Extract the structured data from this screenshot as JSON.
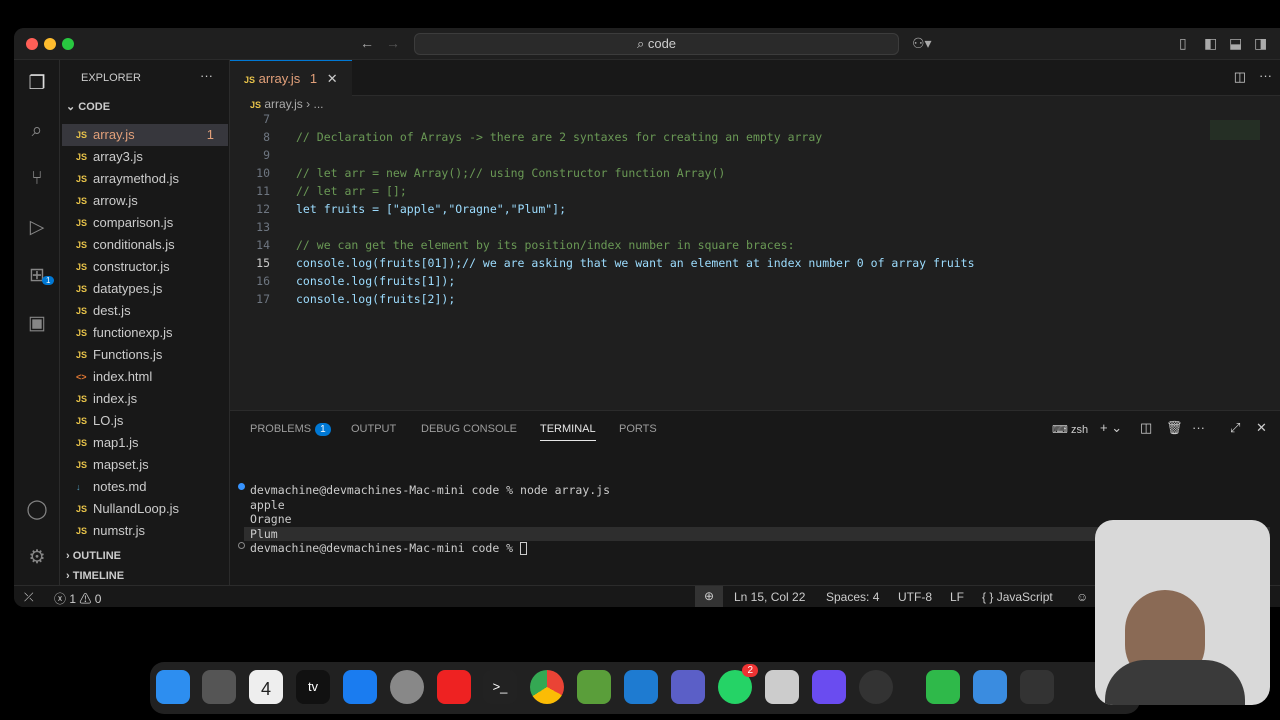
{
  "titlebar": {
    "search": "code"
  },
  "sidebar": {
    "title": "EXPLORER",
    "folder": "CODE",
    "files": [
      {
        "name": "array.js",
        "icon": "JS",
        "badge": "1"
      },
      {
        "name": "array3.js",
        "icon": "JS"
      },
      {
        "name": "arraymethod.js",
        "icon": "JS"
      },
      {
        "name": "arrow.js",
        "icon": "JS"
      },
      {
        "name": "comparison.js",
        "icon": "JS"
      },
      {
        "name": "conditionals.js",
        "icon": "JS"
      },
      {
        "name": "constructor.js",
        "icon": "JS"
      },
      {
        "name": "datatypes.js",
        "icon": "JS"
      },
      {
        "name": "dest.js",
        "icon": "JS"
      },
      {
        "name": "functionexp.js",
        "icon": "JS"
      },
      {
        "name": "Functions.js",
        "icon": "JS"
      },
      {
        "name": "index.html",
        "icon": "<>"
      },
      {
        "name": "index.js",
        "icon": "JS"
      },
      {
        "name": "LO.js",
        "icon": "JS"
      },
      {
        "name": "map1.js",
        "icon": "JS"
      },
      {
        "name": "mapset.js",
        "icon": "JS"
      },
      {
        "name": "notes.md",
        "icon": "↓"
      },
      {
        "name": "NullandLoop.js",
        "icon": "JS"
      },
      {
        "name": "numstr.js",
        "icon": "JS"
      }
    ],
    "outline": "OUTLINE",
    "timeline": "TIMELINE",
    "extensions_badge": "1"
  },
  "tab": {
    "icon": "JS",
    "name": "array.js",
    "count": "1"
  },
  "breadcrumb": {
    "file": "array.js",
    "more": "..."
  },
  "editor": {
    "lines": [
      {
        "n": "7",
        "t": ""
      },
      {
        "n": "8",
        "t": "// Declaration of Arrays -> there are 2 syntaxes for creating an empty array"
      },
      {
        "n": "9",
        "t": ""
      },
      {
        "n": "10",
        "t": "// let arr = new Array();// using Constructor function Array()"
      },
      {
        "n": "11",
        "t": "// let arr = [];"
      },
      {
        "n": "12",
        "t": "let fruits = [\"apple\",\"Oragne\",\"Plum\"];"
      },
      {
        "n": "13",
        "t": ""
      },
      {
        "n": "14",
        "t": "// we can get the element by its position/index number in square braces:"
      },
      {
        "n": "15",
        "t": "console.log(fruits[01]);// we are asking that we want an element at index number 0 of array fruits"
      },
      {
        "n": "16",
        "t": "console.log(fruits[1]);"
      },
      {
        "n": "17",
        "t": "console.log(fruits[2]);"
      }
    ]
  },
  "panel": {
    "tabs": [
      "PROBLEMS",
      "OUTPUT",
      "DEBUG CONSOLE",
      "TERMINAL",
      "PORTS"
    ],
    "problems_count": "1",
    "shell": "zsh",
    "terminal": [
      "devmachine@devmachines-Mac-mini code % node array.js",
      "apple",
      "Oragne",
      "Plum",
      "devmachine@devmachines-Mac-mini code % "
    ]
  },
  "status": {
    "errors": "1",
    "warnings": "0",
    "position": "Ln 15, Col 22",
    "spaces": "Spaces: 4",
    "encoding": "UTF-8",
    "eol": "LF",
    "language": "JavaScript"
  },
  "dock": {
    "calendar_day": "4",
    "whatsapp_badge": "2"
  }
}
